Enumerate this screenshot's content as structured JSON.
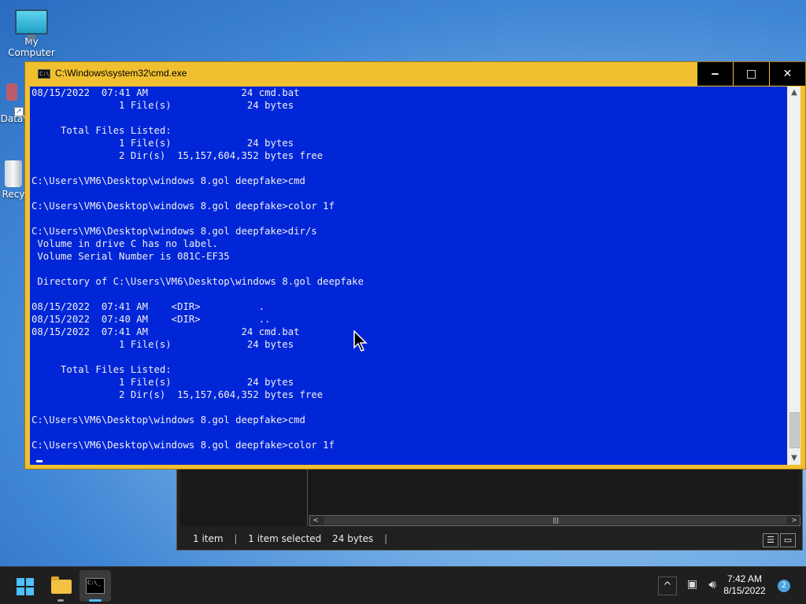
{
  "desktop": {
    "icons": [
      {
        "label": "My Computer"
      },
      {
        "label": "Data\\"
      },
      {
        "label": "Recy"
      }
    ]
  },
  "cmd_window": {
    "title": "C:\\Windows\\system32\\cmd.exe",
    "buttons": {
      "minimize": "‒",
      "maximize": "□",
      "close": "✕"
    },
    "output": "08/15/2022  07:41 AM                24 cmd.bat\n               1 File(s)             24 bytes\n\n     Total Files Listed:\n               1 File(s)             24 bytes\n               2 Dir(s)  15,157,604,352 bytes free\n\nC:\\Users\\VM6\\Desktop\\windows 8.gol deepfake>cmd\n\nC:\\Users\\VM6\\Desktop\\windows 8.gol deepfake>color 1f\n\nC:\\Users\\VM6\\Desktop\\windows 8.gol deepfake>dir/s\n Volume in drive C has no label.\n Volume Serial Number is 081C-EF35\n\n Directory of C:\\Users\\VM6\\Desktop\\windows 8.gol deepfake\n\n08/15/2022  07:41 AM    <DIR>          .\n08/15/2022  07:40 AM    <DIR>          ..\n08/15/2022  07:41 AM                24 cmd.bat\n               1 File(s)             24 bytes\n\n     Total Files Listed:\n               1 File(s)             24 bytes\n               2 Dir(s)  15,157,604,352 bytes free\n\nC:\\Users\\VM6\\Desktop\\windows 8.gol deepfake>cmd\n\nC:\\Users\\VM6\\Desktop\\windows 8.gol deepfake>color 1f",
    "colors": {
      "background": "#0026d8",
      "foreground": "#f0f0f0",
      "frame": "#f0c030"
    }
  },
  "explorer_window": {
    "status": {
      "item_count": "1 item",
      "selection": "1 item selected",
      "size": "24 bytes"
    }
  },
  "taskbar": {
    "icons": [
      "start-icon",
      "file-explorer-icon",
      "command-prompt-icon"
    ],
    "clock": {
      "time": "7:42 AM",
      "date": "8/15/2022"
    },
    "notification_count": "2"
  }
}
